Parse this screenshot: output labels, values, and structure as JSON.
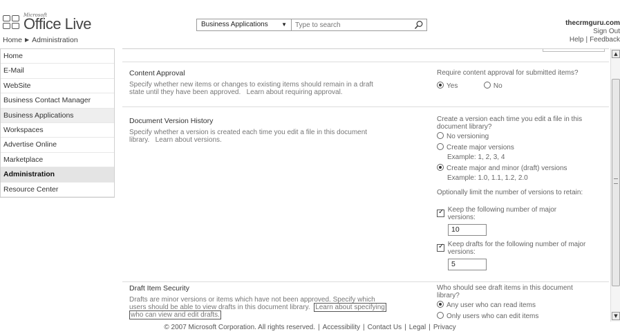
{
  "header": {
    "logo_brand": "Microsoft",
    "logo_name": "Office Live",
    "breadcrumb": [
      "Home",
      "Administration"
    ],
    "search": {
      "category": "Business Applications",
      "placeholder": "Type to search"
    },
    "user": "thecrmguru.com",
    "sign_out": "Sign Out",
    "help": "Help",
    "feedback": "Feedback"
  },
  "sidebar": {
    "items": [
      {
        "label": "Home"
      },
      {
        "label": "E-Mail"
      },
      {
        "label": "WebSite"
      },
      {
        "label": "Business Contact Manager"
      },
      {
        "label": "Business Applications"
      },
      {
        "label": "Workspaces"
      },
      {
        "label": "Advertise Online"
      },
      {
        "label": "Marketplace"
      },
      {
        "label": "Administration"
      },
      {
        "label": "Resource Center"
      }
    ],
    "active": "Administration"
  },
  "content_approval": {
    "title": "Content Approval",
    "desc_1": "Specify whether new items or changes to existing items should remain in a draft",
    "desc_2": "state until they have been approved.",
    "desc_link": "Learn about requiring approval.",
    "question": "Require content approval for submitted items?",
    "yes": "Yes",
    "no": "No",
    "selected": "Yes"
  },
  "version_history": {
    "title": "Document Version History",
    "desc_1": "Specify whether a version is created each time you edit a file in this document",
    "desc_2": "library.",
    "desc_link": "Learn about versions.",
    "question": "Create a version each time you edit a file in this document library?",
    "opt_none": "No versioning",
    "opt_major": "Create major versions",
    "opt_major_example": "Example: 1, 2, 3, 4",
    "opt_minor": "Create major and minor (draft) versions",
    "opt_minor_example": "Example: 1.0, 1.1, 1.2, 2.0",
    "selected": "Create major and minor (draft) versions",
    "limit_question": "Optionally limit the number of versions to retain:",
    "keep_major_label": "Keep the following number of major versions:",
    "keep_major_value": "10",
    "keep_drafts_label": "Keep drafts for the following number of major versions:",
    "keep_drafts_value": "5"
  },
  "draft_security": {
    "title": "Draft Item Security",
    "desc_1": "Drafts are minor versions or items which have not been approved. Specify which",
    "desc_2": "users should be able to view drafts in this document library.",
    "desc_link_1": "Learn about specifying",
    "desc_link_2": "who can view and edit drafts.",
    "question": "Who should see draft items in this document library?",
    "opt_any": "Any user who can read items",
    "opt_edit": "Only users who can edit items",
    "selected": "Any user who can read items"
  },
  "footer": {
    "copyright": "© 2007 Microsoft Corporation. All rights reserved.",
    "links": [
      "Accessibility",
      "Contact Us",
      "Legal",
      "Privacy"
    ]
  }
}
